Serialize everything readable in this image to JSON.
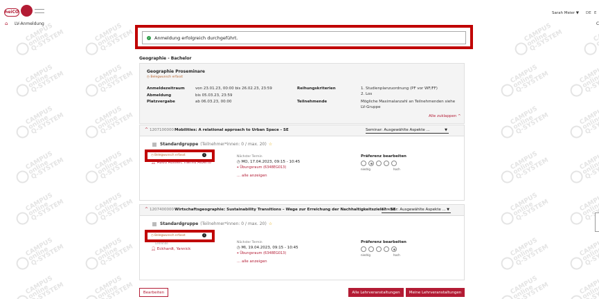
{
  "header": {
    "logo_text": "heiCO",
    "user_name": "Sarah Meier",
    "user_caret": "▼",
    "lang_current": "DE",
    "lang_other": "E"
  },
  "nav": {
    "home_icon": "home-icon",
    "label": "LV-Anmeldung",
    "right_fragment": "C"
  },
  "watermark": {
    "line1": "CAMPUS",
    "line2": "online",
    "line3": "Q-SYSTEM"
  },
  "success": {
    "message": "Anmeldung erfolgreich durchgeführt.",
    "icon": "check-circle-icon"
  },
  "page_subtitle": "Geographie - Bachelor",
  "procedure": {
    "title": "Geographie Proseminare",
    "status": "Belegwunsch erfasst",
    "fields_left": [
      {
        "label": "Anmeldezeitraum",
        "value": "von 23.01.23, 00:00 bis 26.02.23, 23:59"
      },
      {
        "label": "Abmeldung",
        "value": "bis 05.03.23, 23:59"
      },
      {
        "label": "Platzvergabe",
        "value": "ab 06.03.23, 00:00"
      }
    ],
    "fields_right": [
      {
        "label": "Reihungskriterien",
        "value_line1": "1. Studienplanzuordnung (PF vor WF/FF)",
        "value_line2": "2. Los"
      },
      {
        "label": "Teilnehmende",
        "value_line1": "Mögliche Maximalanzahl an Teilnehmenden siehe",
        "value_line2": "LV-Gruppe"
      }
    ],
    "collapse_link": "Alle zuklappen",
    "collapse_caret": "^"
  },
  "courses": [
    {
      "number": "1207100000",
      "name": "Mobilities: A relational approach to Urban Space - SE",
      "select": "Seminar: Ausgewählte Aspekte ...",
      "group_name": "Standardgruppe",
      "participants": "(Teilnehmer*innen: 0 / max. 20)",
      "status": "Belegwunsch erfasst",
      "lecturer_label": "",
      "lecturer": "Abud Russell, Hamid Alberto",
      "next_label": "Nächster Termin",
      "next_date": "MO, 17.04.2023, 09:15 - 10:45",
      "next_room": "Übungsraum (6348EG013)",
      "all_link": "... alle anzeigen",
      "pref_title": "Präferenz bearbeiten",
      "pref_selected": 1,
      "pref_low": "niedrig",
      "pref_high": "hoch"
    },
    {
      "number": "1207400000",
      "name": "Wirtschaftsgeographie: Sustainability Transitions – Wege zur Erreichung der Nachhaltigkeitsziele? - SE",
      "select": "Seminar: Ausgewählte Aspekte ...",
      "group_name": "Standardgruppe",
      "participants": "(Teilnehmer*innen: 0 / max. 20)",
      "status": "Belegwunsch erfasst",
      "lecturer_label": "Lehrende",
      "lecturer": "Eckhardt, Yannick",
      "next_label": "Nächster Termin",
      "next_date": "MI, 19.04.2023, 09:15 - 10:45",
      "next_room": "Übungsraum (6348EG013)",
      "all_link": "... alle anzeigen",
      "pref_title": "Präferenz bearbeiten",
      "pref_selected": 4,
      "pref_low": "niedrig",
      "pref_high": "hoch"
    }
  ],
  "footer": {
    "edit_button": "Bearbeiten",
    "all_courses_button": "Alle Lehrveranstaltungen",
    "my_courses_button": "Meine Lehrveranstaltungen"
  },
  "colors": {
    "brand": "#b31b34",
    "highlight": "#c00000",
    "success": "#2e9e4a"
  }
}
